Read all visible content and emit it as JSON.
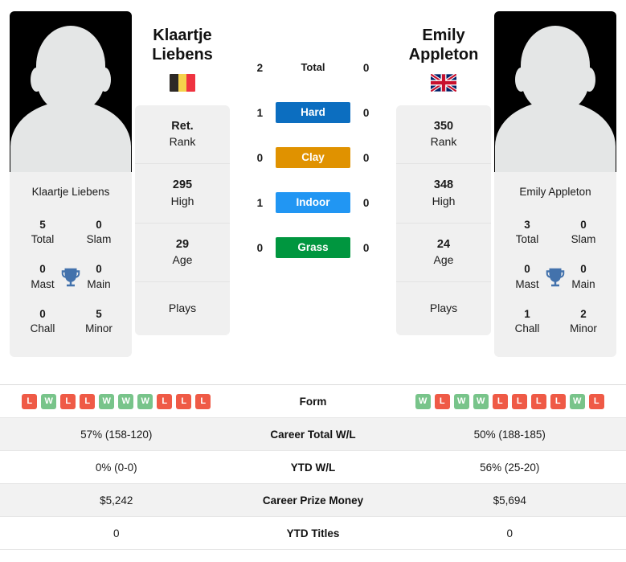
{
  "players": {
    "left": {
      "first_name": "Klaartje",
      "last_name": "Liebens",
      "full_name": "Klaartje Liebens",
      "country": "Belgium",
      "flag_icon": "flag-belgium",
      "flag_colors": [
        "#2D2926",
        "#F5D24B",
        "#EF3340"
      ],
      "titles": {
        "total_value": "5",
        "total_label": "Total",
        "slam_value": "0",
        "slam_label": "Slam",
        "mast_value": "0",
        "mast_label": "Mast",
        "main_value": "0",
        "main_label": "Main",
        "chall_value": "0",
        "chall_label": "Chall",
        "minor_value": "5",
        "minor_label": "Minor"
      },
      "info": {
        "rank_value": "Ret.",
        "rank_label": "Rank",
        "high_value": "295",
        "high_label": "High",
        "age_value": "29",
        "age_label": "Age",
        "plays_label": "Plays",
        "plays_value": ""
      },
      "h2h": {
        "total": "2",
        "hard": "1",
        "clay": "0",
        "indoor": "1",
        "grass": "0"
      },
      "form": [
        "L",
        "W",
        "L",
        "L",
        "W",
        "W",
        "W",
        "L",
        "L",
        "L"
      ],
      "career_total_wl": "57% (158-120)",
      "ytd_wl": "0% (0-0)",
      "career_prize_money": "$5,242",
      "ytd_titles": "0"
    },
    "right": {
      "first_name": "Emily",
      "last_name": "Appleton",
      "full_name": "Emily Appleton",
      "country": "United Kingdom",
      "flag_icon": "flag-united-kingdom",
      "titles": {
        "total_value": "3",
        "total_label": "Total",
        "slam_value": "0",
        "slam_label": "Slam",
        "mast_value": "0",
        "mast_label": "Mast",
        "main_value": "0",
        "main_label": "Main",
        "chall_value": "1",
        "chall_label": "Chall",
        "minor_value": "2",
        "minor_label": "Minor"
      },
      "info": {
        "rank_value": "350",
        "rank_label": "Rank",
        "high_value": "348",
        "high_label": "High",
        "age_value": "24",
        "age_label": "Age",
        "plays_label": "Plays",
        "plays_value": ""
      },
      "h2h": {
        "total": "0",
        "hard": "0",
        "clay": "0",
        "indoor": "0",
        "grass": "0"
      },
      "form": [
        "W",
        "L",
        "W",
        "W",
        "L",
        "L",
        "L",
        "L",
        "W",
        "L"
      ],
      "career_total_wl": "50% (188-185)",
      "ytd_wl": "56% (25-20)",
      "career_prize_money": "$5,694",
      "ytd_titles": "0"
    }
  },
  "surfaces": [
    {
      "key": "total",
      "label": "Total",
      "color": "transparent",
      "text_color": "#1a1a1a"
    },
    {
      "key": "hard",
      "label": "Hard",
      "color": "#0c6ec0",
      "text_color": "#ffffff"
    },
    {
      "key": "clay",
      "label": "Clay",
      "color": "#e09200",
      "text_color": "#ffffff"
    },
    {
      "key": "indoor",
      "label": "Indoor",
      "color": "#2196f3",
      "text_color": "#ffffff"
    },
    {
      "key": "grass",
      "label": "Grass",
      "color": "#00963f",
      "text_color": "#ffffff"
    }
  ],
  "table": {
    "rows": [
      {
        "label": "Form",
        "key": "form",
        "type": "form"
      },
      {
        "label": "Career Total W/L",
        "key": "career_total_wl",
        "type": "text"
      },
      {
        "label": "YTD W/L",
        "key": "ytd_wl",
        "type": "text"
      },
      {
        "label": "Career Prize Money",
        "key": "career_prize_money",
        "type": "text"
      },
      {
        "label": "YTD Titles",
        "key": "ytd_titles",
        "type": "text"
      }
    ]
  },
  "colors": {
    "win_badge": "#78c48a",
    "loss_badge": "#ef5a46",
    "trophy": "#4372ac",
    "card_bg": "#f0f0f0",
    "row_alt_bg": "#f2f2f2"
  },
  "icons": {
    "trophy": "trophy-icon",
    "avatar": "avatar-silhouette-icon"
  }
}
